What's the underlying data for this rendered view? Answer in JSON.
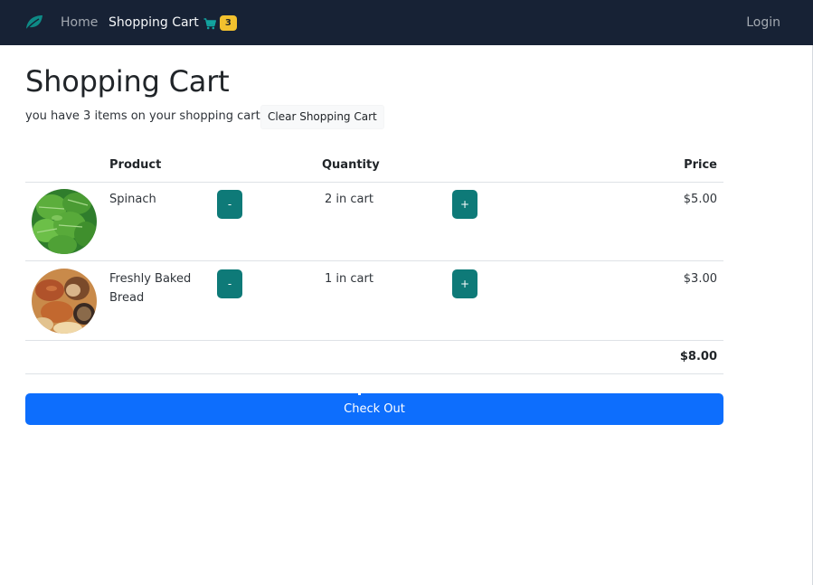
{
  "navbar": {
    "logo_icon": "leaf-icon",
    "home_label": "Home",
    "cart_label": "Shopping Cart",
    "cart_icon": "cart-icon",
    "cart_count": "3",
    "login_label": "Login"
  },
  "page": {
    "title": "Shopping Cart",
    "summary": "you have 3 items on your shopping cart.",
    "clear_label": "Clear Shopping Cart"
  },
  "table": {
    "headers": {
      "product": "Product",
      "quantity": "Quantity",
      "price": "Price"
    },
    "rows": [
      {
        "image": "spinach-image",
        "name": "Spinach",
        "minus": "-",
        "quantity": "2 in cart",
        "plus": "+",
        "price": "$5.00"
      },
      {
        "image": "bread-image",
        "name": "Freshly Baked Bread",
        "minus": "-",
        "quantity": "1 in cart",
        "plus": "+",
        "price": "$3.00"
      }
    ],
    "total": "$8.00"
  },
  "checkout": {
    "label": "Check Out"
  },
  "colors": {
    "navbar": "#172235",
    "accent_teal": "#0e7a78",
    "badge_yellow": "#f2c12e",
    "checkout_blue": "#0d6efd"
  }
}
